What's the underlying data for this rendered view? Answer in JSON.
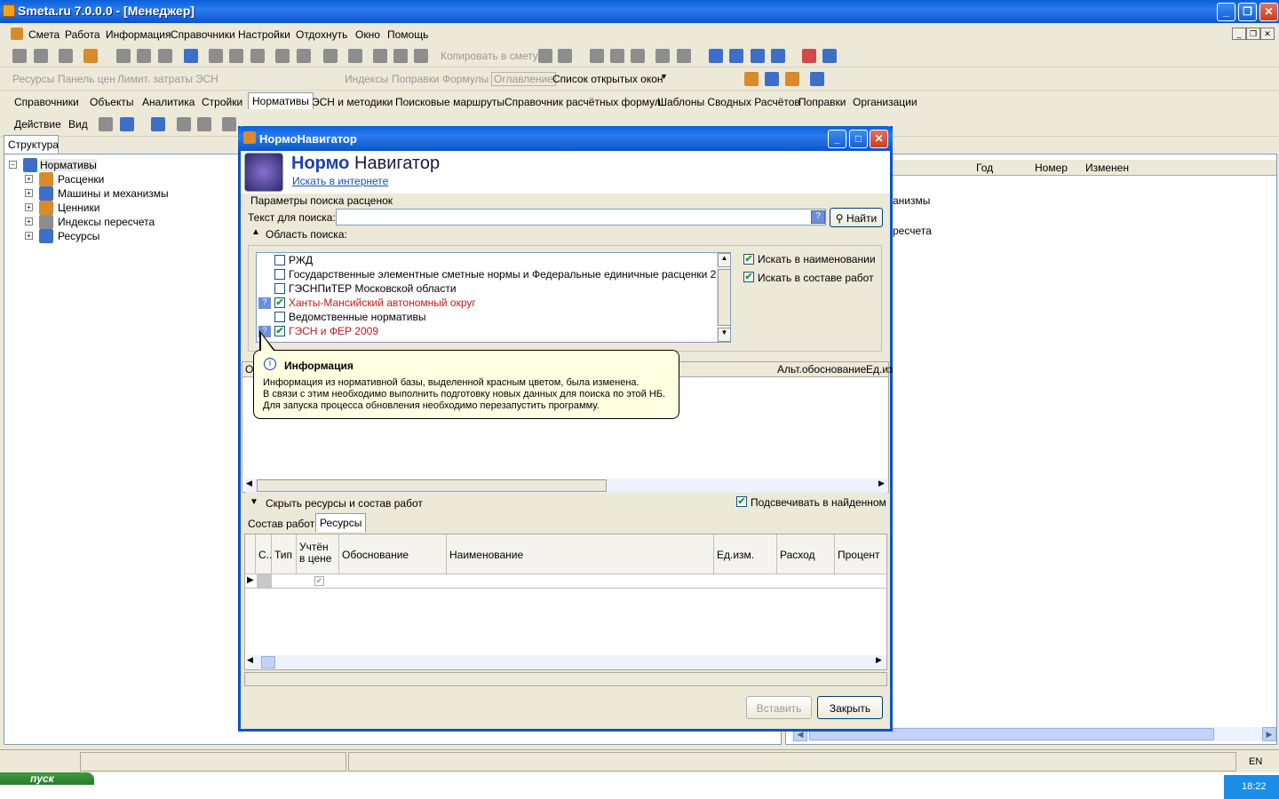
{
  "window": {
    "title": "Smeta.ru  7.0.0.0  - [Менеджер]"
  },
  "menu": [
    "Смета",
    "Работа",
    "Информация",
    "Справочники",
    "Настройки",
    "Отдохнуть",
    "Окно",
    "Помощь"
  ],
  "toolbar2": {
    "items": [
      "Ресурсы",
      "Панель цен",
      "Лимит. затраты",
      "ЭСН",
      "Индексы",
      "Поправки",
      "Формулы",
      "Оглавление"
    ],
    "copy_label": "Копировать в смету",
    "open_windows": "Список открытых окон"
  },
  "tabs": [
    "Справочники",
    "Объекты",
    "Аналитика",
    "Стройки",
    "Нормативы",
    "ЭСН и методики",
    "Поисковые маршруты",
    "Справочник расчётных формул",
    "Шаблоны Сводных Расчётов",
    "Поправки",
    "Организации"
  ],
  "toolbar4": {
    "action": "Действие",
    "view": "Вид"
  },
  "left": {
    "tab": "Структура",
    "root": "Нормативы",
    "children": [
      "Расценки",
      "Машины и механизмы",
      "Ценники",
      "Индексы пересчета",
      "Ресурсы"
    ]
  },
  "right": {
    "cols": [
      "Год",
      "Номер",
      "Изменен"
    ],
    "frag1": "анизмы",
    "frag2": "ресчета"
  },
  "dialog": {
    "title": "НормоНавигатор",
    "brand1": "Нормо",
    "brand2": "Навигатор",
    "link": "Искать в интернете",
    "group": "Параметры поиска расценок",
    "search_label": "Текст для поиска:",
    "search_value": "",
    "find": "Найти",
    "area": "Область поиска:",
    "list": [
      {
        "label": "РЖД",
        "checked": false,
        "red": false
      },
      {
        "label": "Государственные элементные сметные нормы и Федеральные единичные расценки 2001 года",
        "checked": false,
        "red": false
      },
      {
        "label": "ГЭСНПиТЕР Московской области",
        "checked": false,
        "red": false
      },
      {
        "label": "Ханты-Мансийский автономный округ",
        "checked": true,
        "red": true
      },
      {
        "label": "Ведомственные нормативы",
        "checked": false,
        "red": false
      },
      {
        "label": "ГЭСН и ФЕР 2009",
        "checked": true,
        "red": true
      }
    ],
    "opt1": "Искать в наименовании",
    "opt2": "Искать в составе работ",
    "res_cols": [
      "О",
      "Альт.обоснование",
      "Ед.из"
    ],
    "tooltip": {
      "title": "Информация",
      "lines": [
        "Информация из нормативной базы, выделенной красным цветом, была изменена.",
        "В связи с этим необходимо выполнить подготовку новых данных для поиска по этой НБ.",
        "Для запуска процесса обновления необходимо перезапустить программу."
      ]
    },
    "hide": "Скрыть  ресурсы и состав работ",
    "highlight": "Подсвечивать в найденном",
    "subtabs": [
      "Состав работ",
      "Ресурсы"
    ],
    "grid_cols": [
      "С..",
      "Тип",
      "Учтён в цене",
      "Обоснование",
      "Наименование",
      "Ед.изм.",
      "Расход",
      "Процент"
    ],
    "insert": "Вставить",
    "close": "Закрыть"
  },
  "status": {
    "lang": "EN",
    "clock": "18:22",
    "start": "пуск"
  }
}
